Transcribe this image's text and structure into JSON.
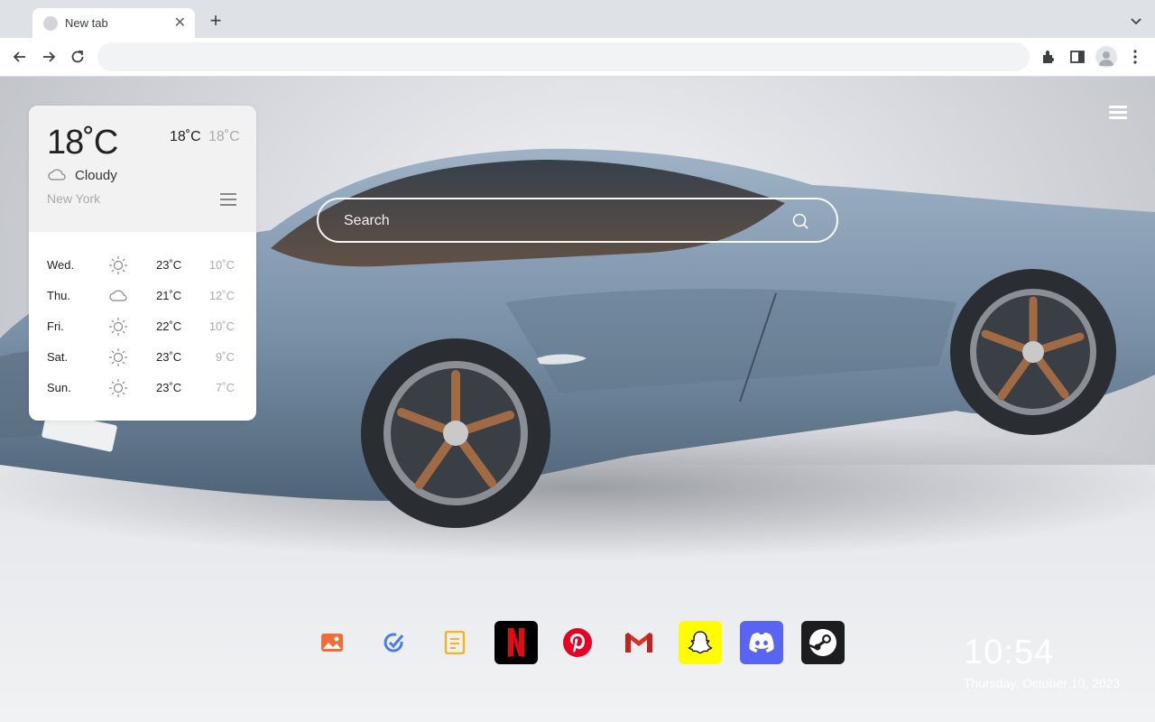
{
  "browser": {
    "tab_title": "New tab",
    "tab_close": "✕",
    "new_tab": "+",
    "address_value": ""
  },
  "weather": {
    "current_temp": "18˚C",
    "high": "18˚C",
    "low": "18˚C",
    "condition": "Cloudy",
    "condition_icon": "cloud-icon",
    "city": "New York",
    "forecast": [
      {
        "day": "Wed.",
        "icon": "sun-icon",
        "high": "23˚C",
        "low": "10˚C"
      },
      {
        "day": "Thu.",
        "icon": "cloud-icon",
        "high": "21˚C",
        "low": "12˚C"
      },
      {
        "day": "Fri.",
        "icon": "sun-icon",
        "high": "22˚C",
        "low": "10˚C"
      },
      {
        "day": "Sat.",
        "icon": "sun-icon",
        "high": "23˚C",
        "low": "9˚C"
      },
      {
        "day": "Sun.",
        "icon": "sun-icon",
        "high": "23˚C",
        "low": "7˚C"
      }
    ]
  },
  "search": {
    "placeholder": "Search",
    "value": ""
  },
  "dock": [
    {
      "name": "wallpaper",
      "icon": "image-icon",
      "color": "#f26b3a"
    },
    {
      "name": "tasks",
      "icon": "check-circle-icon",
      "color": "#4a7cf0"
    },
    {
      "name": "notes",
      "icon": "note-icon",
      "color": "#f2b51b"
    },
    {
      "name": "netflix",
      "icon": "netflix-icon",
      "color": "#e50914"
    },
    {
      "name": "pinterest",
      "icon": "pinterest-icon",
      "color": "#e60023"
    },
    {
      "name": "gmail",
      "icon": "gmail-icon",
      "color": "#d93025"
    },
    {
      "name": "snapchat",
      "icon": "snapchat-icon",
      "color": "#fffc00"
    },
    {
      "name": "discord",
      "icon": "discord-icon",
      "color": "#5865f2"
    },
    {
      "name": "steam",
      "icon": "steam-icon",
      "color": "#171a21"
    }
  ],
  "clock": {
    "time": "10:54",
    "date": "Thursday, October 10, 2023"
  }
}
